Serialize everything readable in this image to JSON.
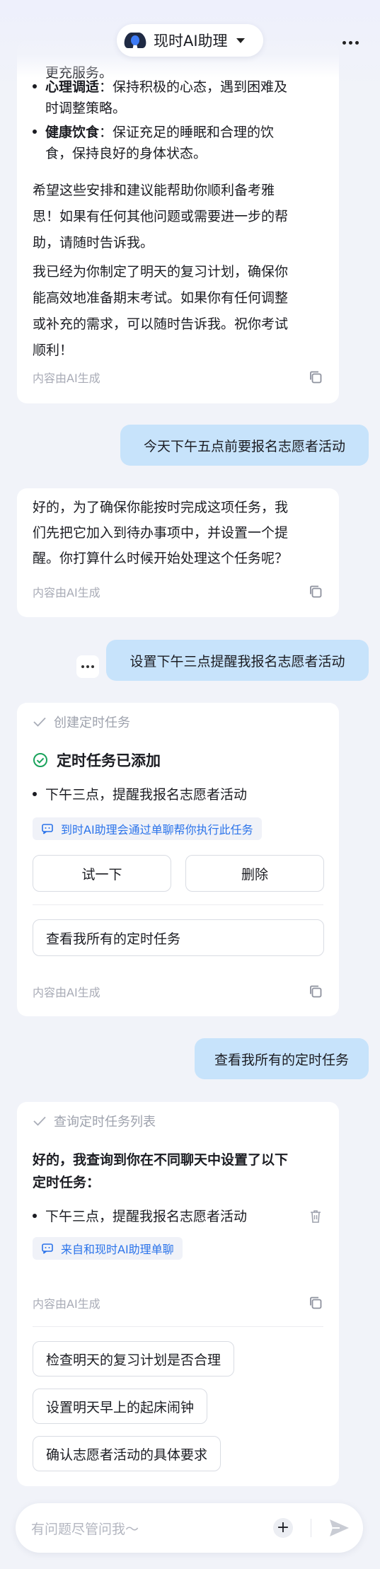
{
  "header": {
    "title": "现时AI助理"
  },
  "card1": {
    "partial_line": "更充服务。",
    "bullets": [
      {
        "bold": "心理调适",
        "text": "：保持积极的心态，遇到困难及",
        "text2": "时调整策略。"
      },
      {
        "bold": "健康饮食",
        "text": "：保证充足的睡眠和合理的饮",
        "text2": "食，保持良好的身体状态。"
      }
    ],
    "para1": [
      "希望这些安排和建议能帮助你顺利备考雅",
      "思！如果有任何其他问题或需要进一步的帮",
      "助，请随时告诉我。"
    ],
    "para2": [
      "我已经为你制定了明天的复习计划，确保你",
      "能高效地准备期末考试。如果你有任何调整",
      "或补充的需求，可以随时告诉我。祝你考试",
      "顺利！"
    ],
    "footer": "内容由AI生成"
  },
  "user1": "今天下午五点前要报名志愿者活动",
  "card2": {
    "lines": [
      "好的，为了确保你能按时完成这项任务，我",
      "们先把它加入到待办事项中，并设置一个提",
      "醒。你打算什么时候开始处理这个任务呢？"
    ],
    "footer": "内容由AI生成"
  },
  "user2": "设置下午三点提醒我报名志愿者活动",
  "card3": {
    "step": "创建定时任务",
    "success_title": "定时任务已添加",
    "task": "下午三点，提醒我报名志愿者活动",
    "chip": "到时AI助理会通过单聊帮你执行此任务",
    "try_button": "试一下",
    "delete_button": "删除",
    "view_all_button": "查看我所有的定时任务",
    "footer": "内容由AI生成"
  },
  "user3": "查看我所有的定时任务",
  "card4": {
    "step": "查询定时任务列表",
    "heading": [
      "好的，我查询到你在不同聊天中设置了以下",
      "定时任务："
    ],
    "task": "下午三点，提醒我报名志愿者活动",
    "chip": "来自和现时AI助理单聊",
    "footer": "内容由AI生成",
    "suggestions": [
      "检查明天的复习计划是否合理",
      "设置明天早上的起床闹钟",
      "确认志愿者活动的具体要求"
    ]
  },
  "input": {
    "placeholder": "有问题尽管问我～"
  },
  "colors": {
    "accent": "#2a73ea",
    "user_bubble": "#c7e3fb",
    "success": "#1aa35c"
  }
}
